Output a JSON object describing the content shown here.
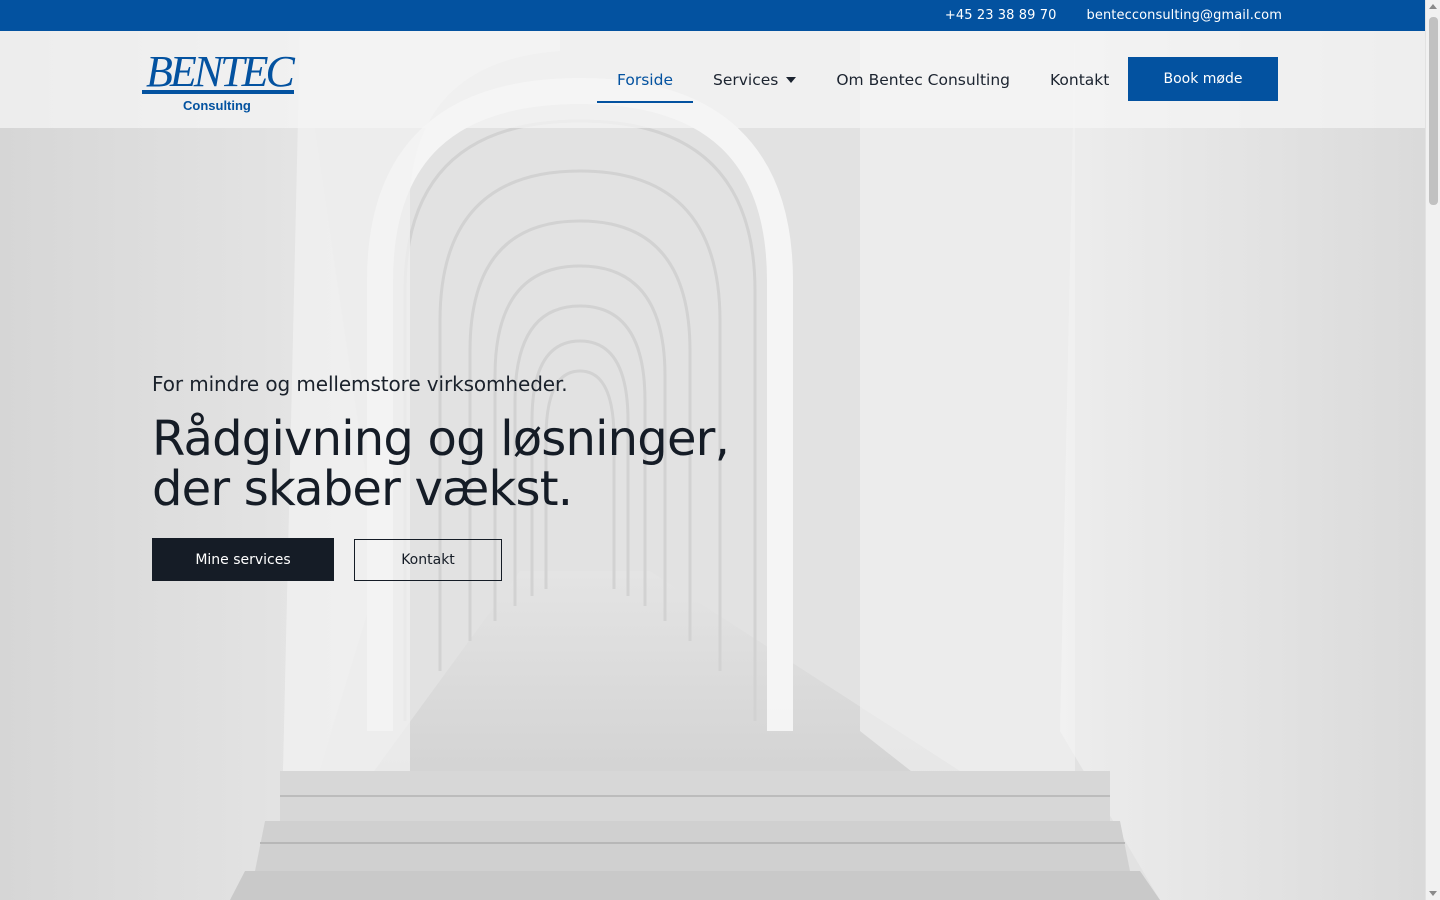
{
  "topbar": {
    "phone": "+45 23 38 89 70",
    "email": "bentecconsulting@gmail.com"
  },
  "logo": {
    "brand": "BENTEC",
    "tagline": "Consulting"
  },
  "nav": {
    "items": [
      {
        "label": "Forside",
        "active": true
      },
      {
        "label": "Services",
        "has_dropdown": true
      },
      {
        "label": "Om Bentec Consulting"
      },
      {
        "label": "Kontakt"
      }
    ],
    "cta": "Book møde"
  },
  "hero": {
    "subtitle": "For mindre og mellemstore virksomheder.",
    "title_line1": "Rådgivning og løsninger,",
    "title_line2": "der skaber vækst.",
    "primary_button": "Mine services",
    "secondary_button": "Kontakt"
  },
  "colors": {
    "brand_blue": "#0352a0",
    "dark": "#151c26"
  },
  "icons": {
    "services_dropdown": "caret-down-icon"
  }
}
